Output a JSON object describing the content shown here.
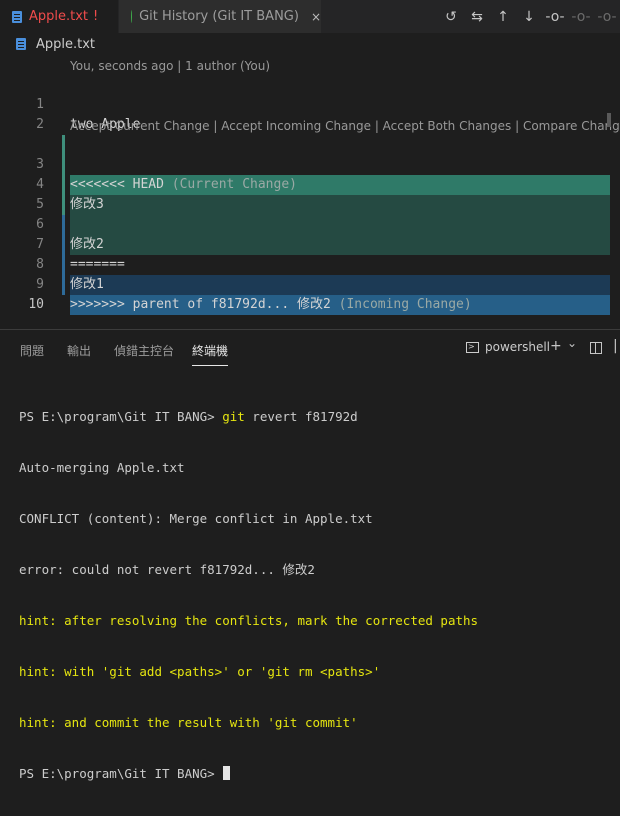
{
  "tabs": {
    "active": {
      "label": "Apple.txt",
      "badge": "!"
    },
    "other": {
      "label": "Git History (Git IT BANG)",
      "close": "×"
    }
  },
  "breadcrumb": {
    "file": "Apple.txt"
  },
  "editor_actions": [
    "history-icon",
    "compare-changes-icon",
    "previous-change-icon",
    "next-change-icon",
    "commit-icon",
    "commit-dim-icon",
    "commit-dim-icon"
  ],
  "editor": {
    "blame": "You, seconds ago | 1 author (You)",
    "conflict_actions": "Accept Current Change | Accept Incoming Change | Accept Both Changes | Compare Changes",
    "lines": [
      {
        "n": "1",
        "text": "two Apple"
      },
      {
        "n": "2",
        "text": ""
      },
      {
        "n": "3",
        "text": "<<<<<<< HEAD",
        "note": "(Current Change)"
      },
      {
        "n": "4",
        "text": "修改3"
      },
      {
        "n": "5",
        "text": ""
      },
      {
        "n": "6",
        "text": "修改2"
      },
      {
        "n": "7",
        "text": "======="
      },
      {
        "n": "8",
        "text": "修改1"
      },
      {
        "n": "9",
        "text": ">>>>>>> parent of f81792d... 修改2",
        "note": "(Incoming Change)"
      },
      {
        "n": "10",
        "text": ""
      }
    ],
    "colors": {
      "current_header": "#2f7a68",
      "current_body": "#254a42",
      "incoming_body": "#1c3a55",
      "incoming_header": "#265f88"
    }
  },
  "panel": {
    "tabs": [
      "問題",
      "輸出",
      "偵錯主控台",
      "終端機"
    ],
    "selected_tab": "終端機",
    "shell": "powershell",
    "add_icon": "+",
    "dropdown_icon": "⌄"
  },
  "terminal": {
    "prompt": "PS E:\\program\\Git IT BANG> ",
    "command_git": "git",
    "command_rest": " revert f81792d",
    "lines": [
      "Auto-merging Apple.txt",
      "CONFLICT (content): Merge conflict in Apple.txt",
      "error: could not revert f81792d... 修改2"
    ],
    "hints": [
      "hint: after resolving the conflicts, mark the corrected paths",
      "hint: with 'git add <paths>' or 'git rm <paths>'",
      "hint: and commit the result with 'git commit'"
    ],
    "final_prompt": "PS E:\\program\\Git IT BANG> "
  }
}
